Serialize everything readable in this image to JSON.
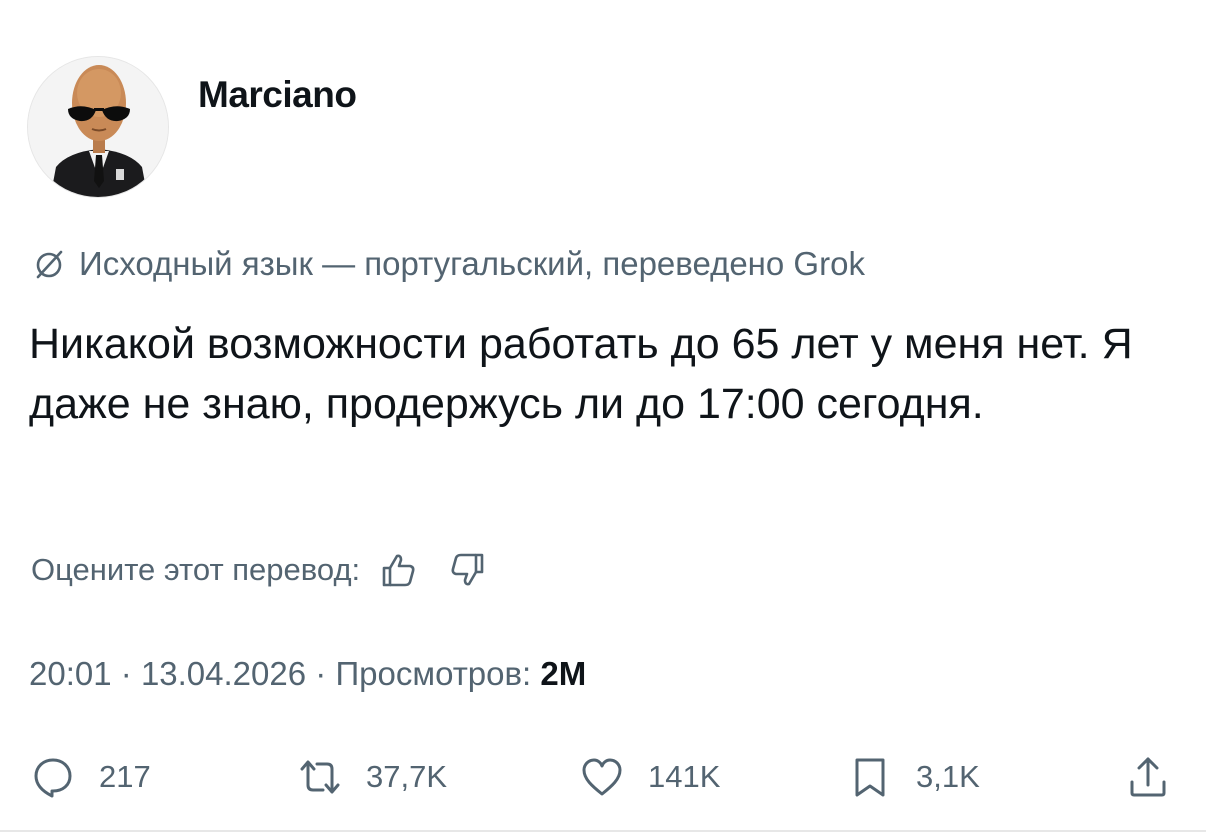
{
  "author": {
    "name": "Marciano"
  },
  "translation_note": "Исходный язык — португальский, переведено Grok",
  "tweet_text": "Никакой возможности работать до 65 лет у меня нет. Я даже не знаю, продержусь ли до 17:00 сегодня.",
  "rate_prompt": "Оцените этот перевод:",
  "meta": {
    "time": "20:01",
    "date": "13.04.2026",
    "views_label": "Просмотров:",
    "views_count": "2M",
    "separator": "·"
  },
  "actions": {
    "replies": "217",
    "retweets": "37,7K",
    "likes": "141K",
    "bookmarks": "3,1K"
  },
  "icons": {
    "translation": "translate-icon",
    "thumbs_up": "thumbs-up-icon",
    "thumbs_down": "thumbs-down-icon",
    "reply": "reply-icon",
    "retweet": "retweet-icon",
    "like": "heart-icon",
    "bookmark": "bookmark-icon",
    "share": "share-icon"
  },
  "colors": {
    "text_primary": "#0f1419",
    "text_secondary": "#536471",
    "background": "#ffffff"
  }
}
